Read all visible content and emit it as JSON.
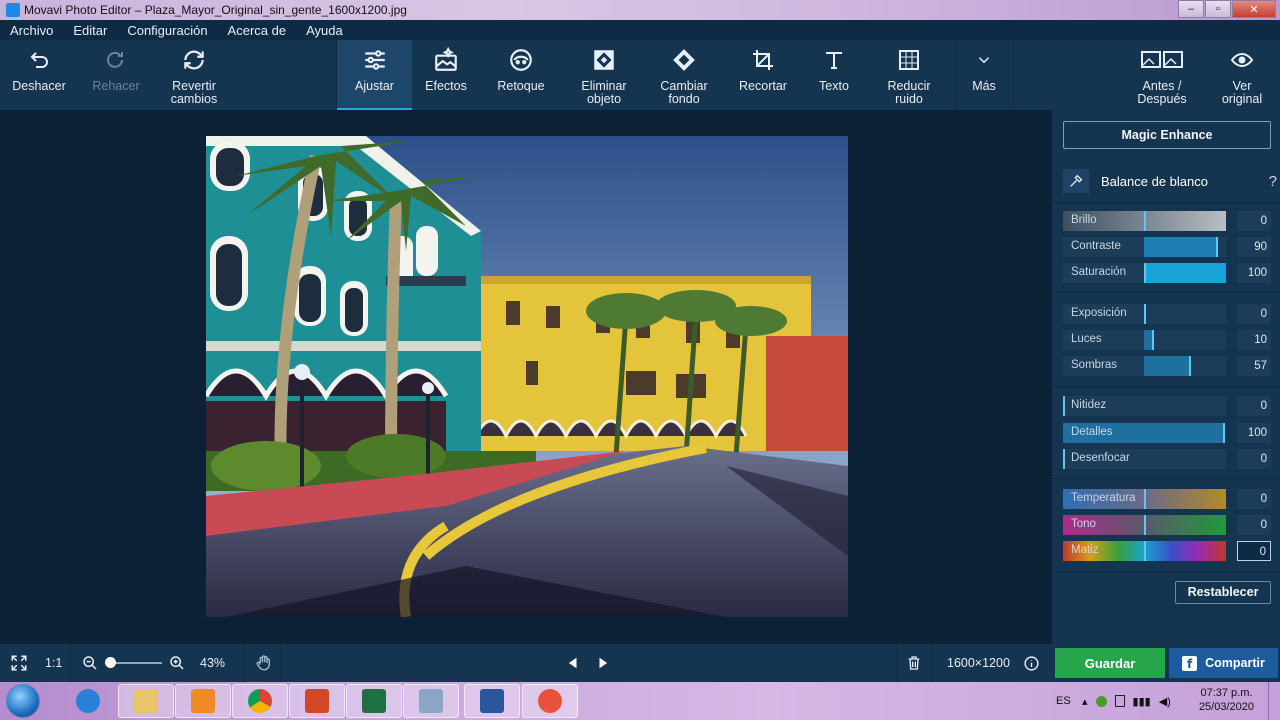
{
  "window": {
    "title": "Movavi Photo Editor – Plaza_Mayor_Original_sin_gente_1600x1200.jpg",
    "minimize": "–",
    "maximize": "▫",
    "close": "✕"
  },
  "menu": [
    "Archivo",
    "Editar",
    "Configuración",
    "Acerca de",
    "Ayuda"
  ],
  "toolbar": {
    "undo": "Deshacer",
    "redo": "Rehacer",
    "revert": "Revertir cambios",
    "adjust": "Ajustar",
    "effects": "Efectos",
    "retouch": "Retoque",
    "remove_object": "Eliminar objeto",
    "change_bg": "Cambiar fondo",
    "crop": "Recortar",
    "text": "Texto",
    "reduce_noise": "Reducir ruido",
    "more": "Más",
    "before_after": "Antes / Después",
    "view_original": "Ver original"
  },
  "panel": {
    "magic_enhance": "Magic Enhance",
    "white_balance": "Balance de blanco",
    "help": "?",
    "sliders": [
      {
        "label": "Brillo",
        "value": "0"
      },
      {
        "label": "Contraste",
        "value": "90"
      },
      {
        "label": "Saturación",
        "value": "100"
      },
      {
        "label": "Exposición",
        "value": "0"
      },
      {
        "label": "Luces",
        "value": "10"
      },
      {
        "label": "Sombras",
        "value": "57"
      },
      {
        "label": "Nitidez",
        "value": "0"
      },
      {
        "label": "Detalles",
        "value": "100"
      },
      {
        "label": "Desenfocar",
        "value": "0"
      },
      {
        "label": "Temperatura",
        "value": "0"
      },
      {
        "label": "Tono",
        "value": "0"
      },
      {
        "label": "Matiz",
        "value": "0"
      }
    ],
    "reset": "Restablecer"
  },
  "bottom": {
    "fit_label": "1:1",
    "zoom": "43%",
    "dimensions": "1600×1200",
    "save": "Guardar",
    "share": "Compartir",
    "fb_glyph": "f"
  },
  "taskbar": {
    "language": "ES",
    "time": "07:37 p.m.",
    "date": "25/03/2020"
  },
  "colors": {
    "accent": "#27a6e6",
    "save_green": "#27a54a",
    "share_blue": "#1e5b9c",
    "panel_bg": "#15344f"
  }
}
